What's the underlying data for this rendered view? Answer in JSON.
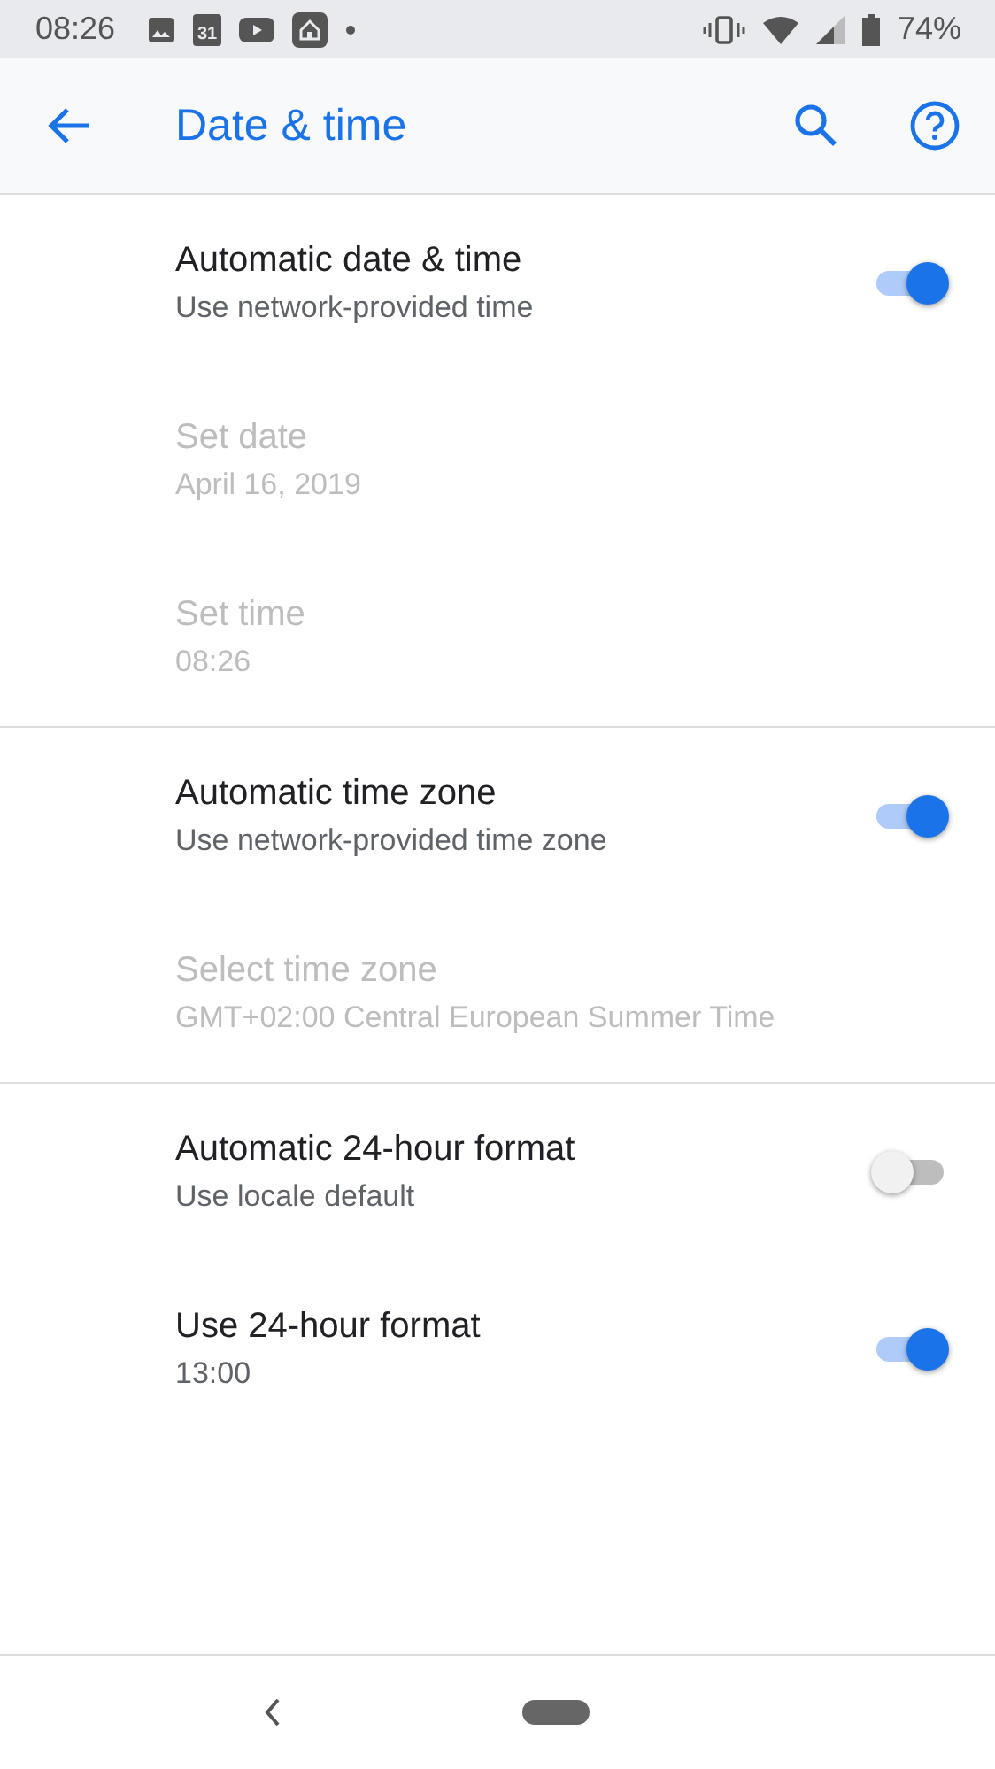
{
  "status_bar": {
    "time": "08:26",
    "calendar_day": "31",
    "battery": "74%"
  },
  "app_bar": {
    "title": "Date & time"
  },
  "sections": [
    {
      "items": [
        {
          "kind": "switch",
          "title": "Automatic date & time",
          "summary": "Use network-provided time",
          "disabled": false,
          "on": true
        },
        {
          "kind": "plain",
          "title": "Set date",
          "summary": "April 16, 2019",
          "disabled": true
        },
        {
          "kind": "plain",
          "title": "Set time",
          "summary": "08:26",
          "disabled": true
        }
      ]
    },
    {
      "items": [
        {
          "kind": "switch",
          "title": "Automatic time zone",
          "summary": "Use network-provided time zone",
          "disabled": false,
          "on": true
        },
        {
          "kind": "plain",
          "title": "Select time zone",
          "summary": "GMT+02:00 Central European Summer Time",
          "disabled": true
        }
      ]
    },
    {
      "items": [
        {
          "kind": "switch",
          "title": "Automatic 24-hour format",
          "summary": "Use locale default",
          "disabled": false,
          "on": false
        },
        {
          "kind": "switch",
          "title": "Use 24-hour format",
          "summary": "13:00",
          "disabled": false,
          "on": true
        }
      ]
    }
  ]
}
